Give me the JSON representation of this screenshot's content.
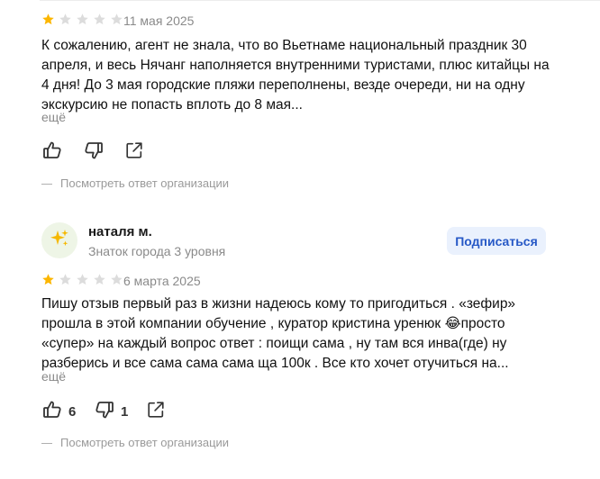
{
  "reviews": [
    {
      "rating": 1,
      "max_rating": 5,
      "date": "11 мая 2025",
      "text": "К сожалению, агент не знала, что во Вьетнаме национальный праздник 30 апреля, и весь Нячанг наполняется внутренними туристами, плюс китайцы на 4 дня! До 3 мая городские пляжи переполнены, везде очереди, ни на одну экскурсию не попасть вплоть до 8 мая...",
      "more_label": "ещё",
      "likes": "",
      "dislikes": "",
      "answer_label": "Посмотреть ответ организации"
    },
    {
      "author_name": "наталя м.",
      "author_level": "Знаток города 3 уровня",
      "avatar_icon": "sparkles-icon",
      "subscribe_label": "Подписаться",
      "rating": 1,
      "max_rating": 5,
      "date": "6 марта 2025",
      "text": "Пишу отзыв первый раз в жизни надеюсь кому то пригодиться . «зефир» прошла в этой компании обучение , куратор кристина уренюк 😂просто «супер» на каждый вопрос ответ : поищи сама , ну там вся инва(где) ну разберись и все сама сама сама ща 100к . Все кто хочет отучиться на...",
      "more_label": "ещё",
      "likes": "6",
      "dislikes": "1",
      "answer_label": "Посмотреть ответ организации"
    }
  ],
  "colors": {
    "star_filled": "#fcb600",
    "star_empty": "#dcdcdc",
    "subscribe_bg": "#eaf1fd",
    "subscribe_text": "#2658c6",
    "muted_text": "#8a8a8a"
  }
}
